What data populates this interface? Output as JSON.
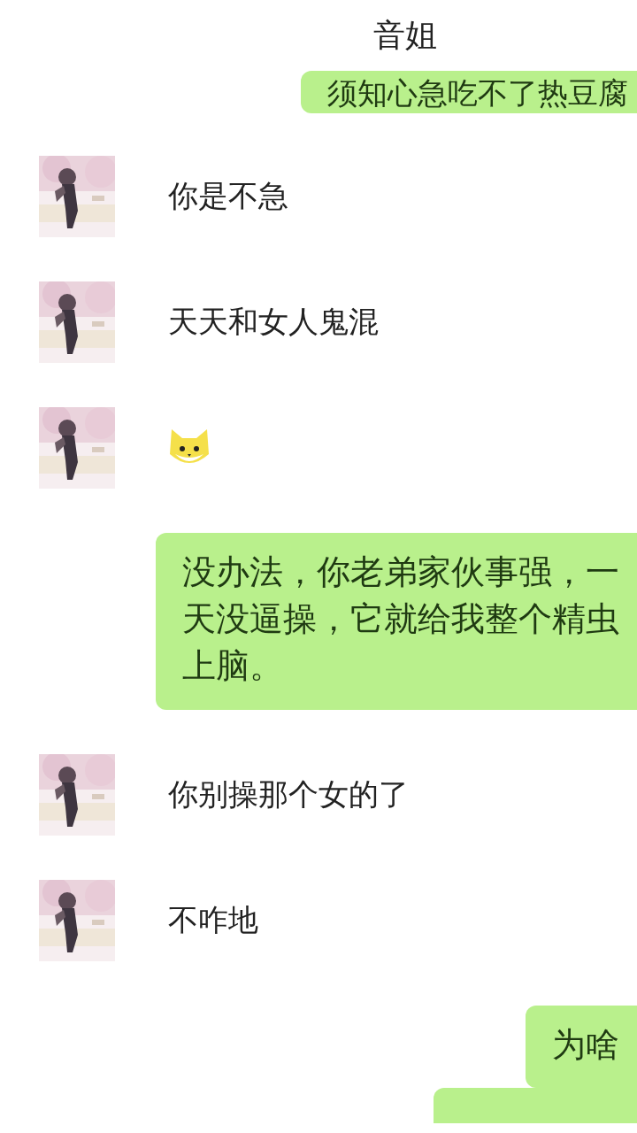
{
  "header": {
    "title": "音姐"
  },
  "messages": [
    {
      "outgoing": true,
      "kind": "text",
      "text": "须知心急吃不了热豆腐"
    },
    {
      "outgoing": false,
      "kind": "text",
      "text": "你是不急"
    },
    {
      "outgoing": false,
      "kind": "text",
      "text": "天天和女人鬼混"
    },
    {
      "outgoing": false,
      "kind": "sticker"
    },
    {
      "outgoing": true,
      "kind": "text",
      "text": "没办法，你老弟家伙事强，一天没逼操，它就给我整个精虫上脑。"
    },
    {
      "outgoing": false,
      "kind": "text",
      "text": "你别操那个女的了"
    },
    {
      "outgoing": false,
      "kind": "text",
      "text": "不咋地"
    },
    {
      "outgoing": true,
      "kind": "text",
      "text": "为啥"
    },
    {
      "outgoing": true,
      "kind": "bubble"
    }
  ]
}
